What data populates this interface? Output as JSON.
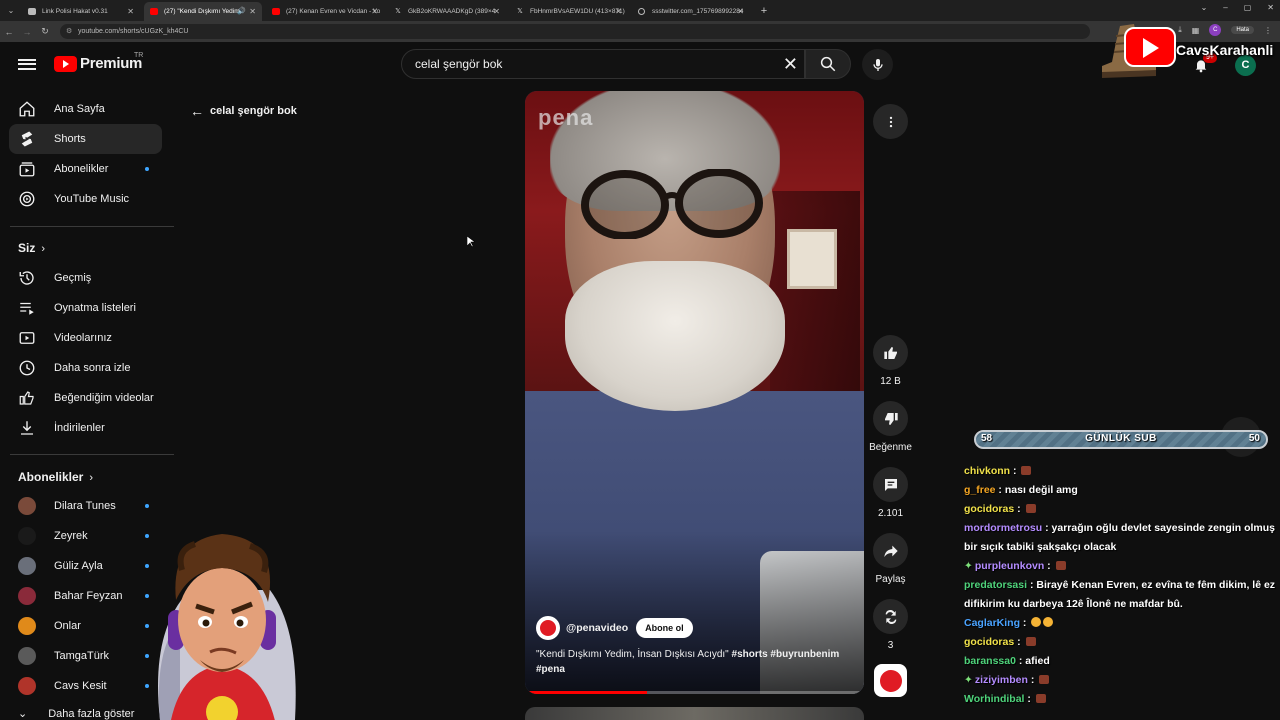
{
  "browser": {
    "tabs": [
      {
        "title": "Link Polisi Hakat v0.31",
        "icon": "page-icon"
      },
      {
        "title": "(27) \"Kendi Dışkımı Yedim,",
        "icon": "youtube-icon"
      },
      {
        "title": "(27) Kenan Evren ve Vicdan - Yo",
        "icon": "youtube-icon"
      },
      {
        "title": "GkB2oKRWAAADKgD (389×4",
        "icon": "x-icon"
      },
      {
        "title": "FbHnmrBVsAEW1DU (413×871)",
        "icon": "x-icon"
      },
      {
        "title": "ssstwitter.com_1757698992284",
        "icon": "globe-icon"
      }
    ],
    "url": "youtube.com/shorts/cUGzK_kh4CU",
    "profile_initial": "C",
    "error_badge": "Hata"
  },
  "header": {
    "logo_text": "Premium",
    "country": "TR",
    "search_value": "celal şengör bok",
    "notification_count": "9+",
    "avatar_initial": "C"
  },
  "sidebar": {
    "main": [
      {
        "label": "Ana Sayfa",
        "icon": "home-icon"
      },
      {
        "label": "Shorts",
        "icon": "shorts-icon"
      },
      {
        "label": "Abonelikler",
        "icon": "subscriptions-icon"
      },
      {
        "label": "YouTube Music",
        "icon": "music-icon"
      }
    ],
    "you_heading": "Siz",
    "you": [
      {
        "label": "Geçmiş",
        "icon": "history-icon"
      },
      {
        "label": "Oynatma listeleri",
        "icon": "playlists-icon"
      },
      {
        "label": "Videolarınız",
        "icon": "your-videos-icon"
      },
      {
        "label": "Daha sonra izle",
        "icon": "watch-later-icon"
      },
      {
        "label": "Beğendiğim videolar",
        "icon": "liked-icon"
      },
      {
        "label": "İndirilenler",
        "icon": "download-icon"
      }
    ],
    "subs_heading": "Abonelikler",
    "subscriptions": [
      {
        "label": "Dilara Tunes",
        "color": "#7a4a3a"
      },
      {
        "label": "Zeyrek",
        "color": "#1a1a1a"
      },
      {
        "label": "Güliz Ayla",
        "color": "#6a6f7a"
      },
      {
        "label": "Bahar Feyzan",
        "color": "#8a2a3a"
      },
      {
        "label": "Onlar",
        "color": "#e08a1a"
      },
      {
        "label": "TamgaTürk",
        "color": "#5a5a5a"
      },
      {
        "label": "Cavs Kesit",
        "color": "#b0342a"
      }
    ],
    "show_more": "Daha fazla göster"
  },
  "shorts": {
    "back_label": "celal şengör bok",
    "watermark": "pena",
    "channel": "@penavideo",
    "subscribe_label": "Abone ol",
    "caption_text": "\"Kendi Dışkımı Yedim, İnsan Dışkısı Acıydı\" ",
    "caption_tags": "#shorts #buyrunbenim #pena",
    "progress": 0.36,
    "like_count": "12 B",
    "dislike_label": "Beğenme",
    "comment_count": "2.101",
    "share_label": "Paylaş",
    "remix_count": "3"
  },
  "overlay": {
    "channel_name": "CavsKarahanli",
    "sub_goal": {
      "label": "GÜNLÜK SUB",
      "current": "58",
      "target": "50",
      "progress": 1.0
    },
    "chat": [
      {
        "user": "chivkonn",
        "color": "#f0e14a",
        "text": "",
        "emote": true
      },
      {
        "user": "g_free",
        "color": "#f5a623",
        "text": "nası değil amg"
      },
      {
        "user": "gocidoras",
        "color": "#f0e14a",
        "text": "",
        "emote": true
      },
      {
        "user": "mordormetrosu",
        "color": "#b48cff",
        "text": "yarrağın oğlu devlet sayesinde zengin olmuş bir sıçık tabiki şakşakçı olacak"
      },
      {
        "user": "purpleunkovn",
        "color": "#b48cff",
        "text": "",
        "emote": true,
        "badge": true
      },
      {
        "user": "predatorsasi",
        "color": "#4fd37b",
        "text": "Birayê Kenan Evren, ez evîna te fêm dikim, lê ez difikirim ku darbeya 12ê Îlonê ne mafdar bû."
      },
      {
        "user": "CaglarKing",
        "color": "#4aa3ff",
        "text": "",
        "smiles": true
      },
      {
        "user": "gocidoras",
        "color": "#f0e14a",
        "text": "",
        "emote": true
      },
      {
        "user": "baranssa0",
        "color": "#4fd37b",
        "text": "afied"
      },
      {
        "user": "ziziyimben",
        "color": "#b48cff",
        "text": "",
        "emote": true,
        "badge": true
      },
      {
        "user": "Worhindibal",
        "color": "#4fd37b",
        "text": "",
        "emote": true
      }
    ]
  }
}
